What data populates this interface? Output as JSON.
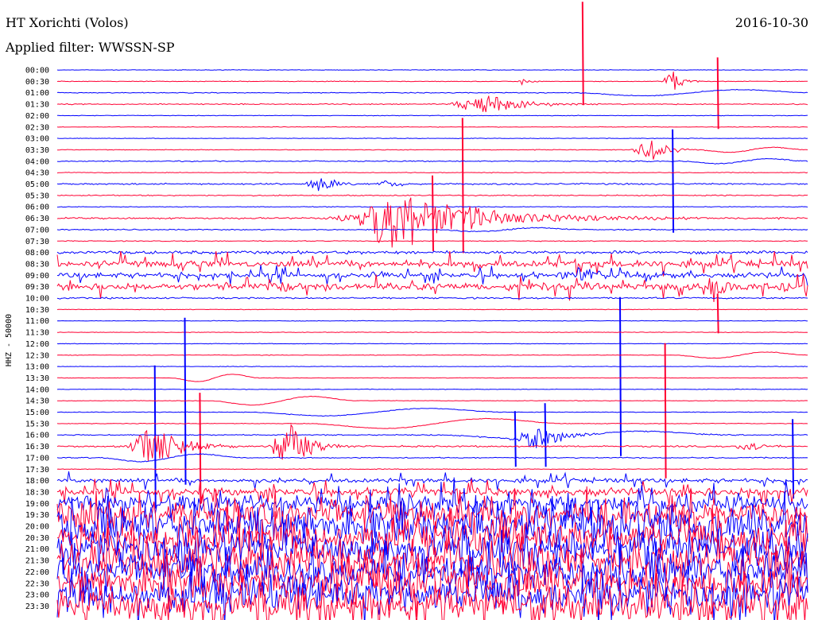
{
  "header": {
    "station": "HT Xorichti (Volos)",
    "date": "2016-10-30",
    "filter": "Applied filter: WWSSN-SP"
  },
  "colors": {
    "trace_a": "#0000ff",
    "trace_b": "#ff0033",
    "text": "#000000"
  },
  "chart_data": {
    "type": "line",
    "subtype": "helicorder",
    "ylabel": "HHZ - 50000",
    "series": [
      {
        "name": "blue traces",
        "color": "#0000ff"
      },
      {
        "name": "red traces",
        "color": "#ff0033"
      }
    ],
    "row_labels": [
      "00:00",
      "00:30",
      "01:00",
      "01:30",
      "02:00",
      "02:30",
      "03:00",
      "03:30",
      "04:00",
      "04:30",
      "05:00",
      "05:30",
      "06:00",
      "06:30",
      "07:00",
      "07:30",
      "08:00",
      "08:30",
      "09:00",
      "09:30",
      "10:00",
      "10:30",
      "11:00",
      "11:30",
      "12:00",
      "12:30",
      "13:00",
      "13:30",
      "14:00",
      "14:30",
      "15:00",
      "15:30",
      "16:00",
      "16:30",
      "17:00",
      "17:30",
      "18:00",
      "18:30",
      "19:00",
      "19:30",
      "20:00",
      "20:30",
      "21:00",
      "21:30",
      "22:00",
      "22:30",
      "23:00",
      "23:30"
    ],
    "row_activity": [
      0.08,
      0.1,
      0.12,
      0.15,
      0.08,
      0.08,
      0.08,
      0.1,
      0.15,
      0.1,
      0.2,
      0.15,
      0.1,
      0.2,
      0.15,
      0.12,
      0.3,
      0.45,
      0.4,
      0.45,
      0.2,
      0.08,
      0.08,
      0.08,
      0.08,
      0.08,
      0.06,
      0.06,
      0.08,
      0.08,
      0.1,
      0.1,
      0.15,
      0.2,
      0.15,
      0.1,
      0.35,
      0.5,
      0.7,
      0.9,
      1.0,
      1.0,
      1.0,
      1.0,
      1.0,
      1.0,
      1.0,
      1.0
    ],
    "events": [
      {
        "row": 1,
        "pos": 0.62,
        "amp": 6,
        "w": 0.01
      },
      {
        "row": 1,
        "pos": 0.82,
        "amp": 14,
        "w": 0.015
      },
      {
        "row": 3,
        "pos": 0.57,
        "amp": 14,
        "w": 0.05
      },
      {
        "row": 7,
        "pos": 0.79,
        "amp": 16,
        "w": 0.025
      },
      {
        "row": 10,
        "pos": 0.35,
        "amp": 10,
        "w": 0.025
      },
      {
        "row": 10,
        "pos": 0.44,
        "amp": 6,
        "w": 0.02
      },
      {
        "row": 13,
        "pos": 0.45,
        "amp": 40,
        "w": 0.06
      },
      {
        "row": 13,
        "pos": 0.5,
        "amp": 16,
        "w": 0.15
      },
      {
        "row": 18,
        "pos": 0.7,
        "amp": 10,
        "w": 0.04
      },
      {
        "row": 19,
        "pos": 0.29,
        "amp": 14,
        "w": 0.02
      },
      {
        "row": 19,
        "pos": 0.88,
        "amp": 18,
        "w": 0.02
      },
      {
        "row": 19,
        "pos": 0.97,
        "amp": 8,
        "w": 0.02
      },
      {
        "row": 33,
        "pos": 0.13,
        "amp": 28,
        "w": 0.04
      },
      {
        "row": 33,
        "pos": 0.31,
        "amp": 30,
        "w": 0.03
      },
      {
        "row": 33,
        "pos": 0.92,
        "amp": 8,
        "w": 0.02
      },
      {
        "row": 32,
        "pos": 0.64,
        "amp": 14,
        "w": 0.04
      }
    ],
    "spikes": [
      {
        "row": 1,
        "pos": 0.7,
        "up": 100,
        "down": 30
      },
      {
        "row": 1,
        "pos": 0.88,
        "up": 30,
        "down": 60
      },
      {
        "row": 7,
        "pos": 0.54,
        "up": 40,
        "down": 130
      },
      {
        "row": 8,
        "pos": 0.82,
        "up": 40,
        "down": 90
      },
      {
        "row": 11,
        "pos": 0.5,
        "up": 25,
        "down": 70
      },
      {
        "row": 21,
        "pos": 0.88,
        "up": 20,
        "down": 30
      },
      {
        "row": 22,
        "pos": 0.75,
        "up": 30,
        "down": 170
      },
      {
        "row": 25,
        "pos": 0.81,
        "up": 15,
        "down": 155
      },
      {
        "row": 28,
        "pos": 0.13,
        "up": 30,
        "down": 150
      },
      {
        "row": 28,
        "pos": 0.17,
        "up": 90,
        "down": 120
      },
      {
        "row": 29,
        "pos": 0.19,
        "up": 10,
        "down": 130
      },
      {
        "row": 32,
        "pos": 0.61,
        "up": 30,
        "down": 40
      },
      {
        "row": 32,
        "pos": 0.65,
        "up": 40,
        "down": 40
      },
      {
        "row": 32,
        "pos": 0.98,
        "up": 20,
        "down": 80
      }
    ],
    "swells": [
      {
        "row": 2,
        "start": 0.68,
        "len": 0.33,
        "amp": 5
      },
      {
        "row": 7,
        "start": 0.85,
        "len": 0.15,
        "amp": 4
      },
      {
        "row": 8,
        "start": 0.83,
        "len": 0.17,
        "amp": 4
      },
      {
        "row": 14,
        "start": 0.5,
        "len": 0.2,
        "amp": 3
      },
      {
        "row": 25,
        "start": 0.82,
        "len": 0.18,
        "amp": 5
      },
      {
        "row": 27,
        "start": 0.15,
        "len": 0.12,
        "amp": 6
      },
      {
        "row": 29,
        "start": 0.2,
        "len": 0.2,
        "amp": 7
      },
      {
        "row": 30,
        "start": 0.25,
        "len": 0.35,
        "amp": 6
      },
      {
        "row": 31,
        "start": 0.33,
        "len": 0.35,
        "amp": 8
      },
      {
        "row": 32,
        "start": 0.5,
        "len": 0.4,
        "amp": 6
      },
      {
        "row": 34,
        "start": 0.05,
        "len": 0.2,
        "amp": 6
      }
    ]
  }
}
